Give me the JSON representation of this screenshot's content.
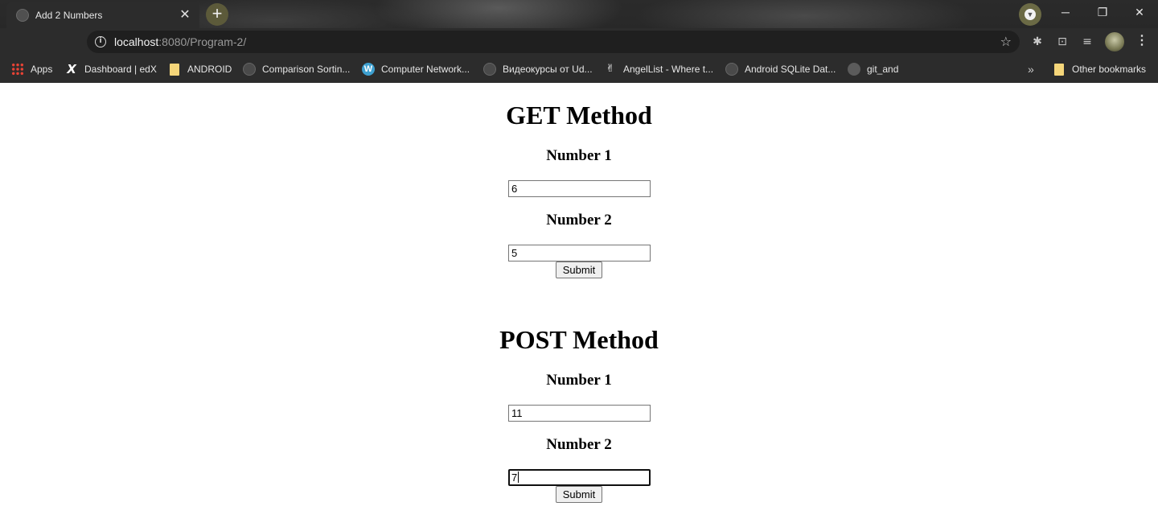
{
  "browser": {
    "tab_title": "Add 2 Numbers",
    "tab_close": "✕",
    "new_tab": "+",
    "window_controls": {
      "minimize": "─",
      "maximize": "❐",
      "close": "✕"
    },
    "url_host": "localhost",
    "url_path": ":8080/Program-2/",
    "info_icon": "i",
    "star_icon": "☆",
    "menu_icon": "⋮",
    "bookmarks": [
      {
        "label": "Apps",
        "icon": "apps-grid-icon"
      },
      {
        "label": "Dashboard | edX",
        "icon": "edx-icon"
      },
      {
        "label": "ANDROID",
        "icon": "folder-icon"
      },
      {
        "label": "Comparison Sortin...",
        "icon": "globe-icon"
      },
      {
        "label": "Computer Network...",
        "icon": "wordpress-icon"
      },
      {
        "label": "Видеокурсы от Ud...",
        "icon": "globe-icon"
      },
      {
        "label": "AngelList - Where t...",
        "icon": "angellist-icon"
      },
      {
        "label": "Android SQLite Dat...",
        "icon": "globe-icon"
      },
      {
        "label": "git_and",
        "icon": "github-icon"
      }
    ],
    "bookmarks_more": "»",
    "other_bookmarks": "Other bookmarks"
  },
  "get_form": {
    "heading": "GET Method",
    "label1": "Number 1",
    "value1": "6",
    "label2": "Number 2",
    "value2": "5",
    "submit": "Submit"
  },
  "post_form": {
    "heading": "POST Method",
    "label1": "Number 1",
    "value1": "11",
    "label2": "Number 2",
    "value2": "7",
    "submit": "Submit"
  }
}
